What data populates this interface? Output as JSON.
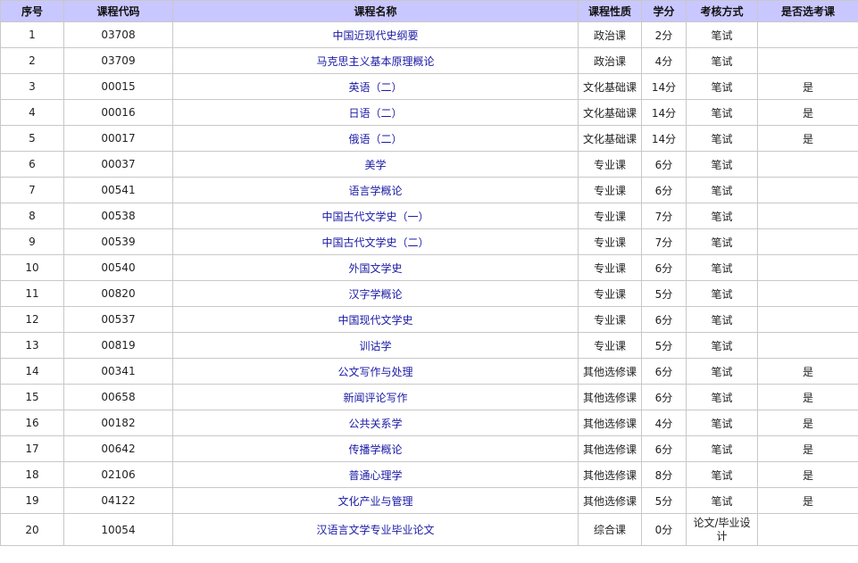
{
  "columns": [
    "序号",
    "课程代码",
    "课程名称",
    "课程性质",
    "学分",
    "考核方式",
    "是否选考课"
  ],
  "rows": [
    {
      "no": "1",
      "code": "03708",
      "name": "中国近现代史纲要",
      "type": "政治课",
      "credit": "2分",
      "exam": "笔试",
      "elective": ""
    },
    {
      "no": "2",
      "code": "03709",
      "name": "马克思主义基本原理概论",
      "type": "政治课",
      "credit": "4分",
      "exam": "笔试",
      "elective": ""
    },
    {
      "no": "3",
      "code": "00015",
      "name": "英语（二）",
      "type": "文化基础课",
      "credit": "14分",
      "exam": "笔试",
      "elective": "是"
    },
    {
      "no": "4",
      "code": "00016",
      "name": "日语（二）",
      "type": "文化基础课",
      "credit": "14分",
      "exam": "笔试",
      "elective": "是"
    },
    {
      "no": "5",
      "code": "00017",
      "name": "俄语（二）",
      "type": "文化基础课",
      "credit": "14分",
      "exam": "笔试",
      "elective": "是"
    },
    {
      "no": "6",
      "code": "00037",
      "name": "美学",
      "type": "专业课",
      "credit": "6分",
      "exam": "笔试",
      "elective": ""
    },
    {
      "no": "7",
      "code": "00541",
      "name": "语言学概论",
      "type": "专业课",
      "credit": "6分",
      "exam": "笔试",
      "elective": ""
    },
    {
      "no": "8",
      "code": "00538",
      "name": "中国古代文学史（一）",
      "type": "专业课",
      "credit": "7分",
      "exam": "笔试",
      "elective": ""
    },
    {
      "no": "9",
      "code": "00539",
      "name": "中国古代文学史（二）",
      "type": "专业课",
      "credit": "7分",
      "exam": "笔试",
      "elective": ""
    },
    {
      "no": "10",
      "code": "00540",
      "name": "外国文学史",
      "type": "专业课",
      "credit": "6分",
      "exam": "笔试",
      "elective": ""
    },
    {
      "no": "11",
      "code": "00820",
      "name": "汉字学概论",
      "type": "专业课",
      "credit": "5分",
      "exam": "笔试",
      "elective": ""
    },
    {
      "no": "12",
      "code": "00537",
      "name": "中国现代文学史",
      "type": "专业课",
      "credit": "6分",
      "exam": "笔试",
      "elective": ""
    },
    {
      "no": "13",
      "code": "00819",
      "name": "训诂学",
      "type": "专业课",
      "credit": "5分",
      "exam": "笔试",
      "elective": ""
    },
    {
      "no": "14",
      "code": "00341",
      "name": "公文写作与处理",
      "type": "其他选修课",
      "credit": "6分",
      "exam": "笔试",
      "elective": "是"
    },
    {
      "no": "15",
      "code": "00658",
      "name": "新闻评论写作",
      "type": "其他选修课",
      "credit": "6分",
      "exam": "笔试",
      "elective": "是"
    },
    {
      "no": "16",
      "code": "00182",
      "name": "公共关系学",
      "type": "其他选修课",
      "credit": "4分",
      "exam": "笔试",
      "elective": "是"
    },
    {
      "no": "17",
      "code": "00642",
      "name": "传播学概论",
      "type": "其他选修课",
      "credit": "6分",
      "exam": "笔试",
      "elective": "是"
    },
    {
      "no": "18",
      "code": "02106",
      "name": "普通心理学",
      "type": "其他选修课",
      "credit": "8分",
      "exam": "笔试",
      "elective": "是"
    },
    {
      "no": "19",
      "code": "04122",
      "name": "文化产业与管理",
      "type": "其他选修课",
      "credit": "5分",
      "exam": "笔试",
      "elective": "是"
    },
    {
      "no": "20",
      "code": "10054",
      "name": "汉语言文学专业毕业论文",
      "type": "综合课",
      "credit": "0分",
      "exam": "论文/毕业设计",
      "elective": ""
    }
  ],
  "colors": {
    "header_bg": "#c9c7ff",
    "link": "#1a1aa6",
    "border": "#c8c8c8"
  }
}
